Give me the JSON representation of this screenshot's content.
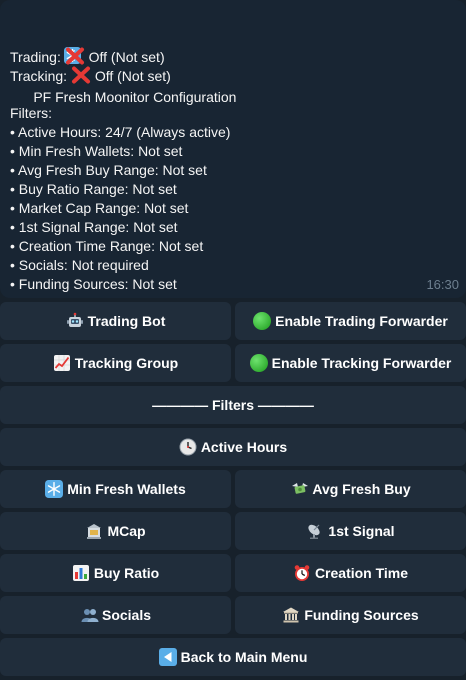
{
  "message": {
    "title_icon": "snowflake-icon",
    "title": "PF Fresh Moonitor Configuration",
    "trading_label": "Trading:",
    "trading_status": "Off (Not set)",
    "tracking_label": "Tracking:",
    "tracking_status": "Off (Not set)",
    "filters_heading": "Filters:",
    "filters": [
      "• Active Hours: 24/7 (Always active)",
      "• Min Fresh Wallets: Not set",
      "• Avg Fresh Buy Range: Not set",
      "• Buy Ratio Range: Not set",
      "• Market Cap Range: Not set",
      "• 1st Signal Range: Not set",
      "• Creation Time Range: Not set",
      "• Socials: Not required",
      "• Funding Sources: Not set"
    ],
    "time": "16:30"
  },
  "keyboard": {
    "trading_bot": "Trading Bot",
    "enable_trading_forwarder": "Enable Trading Forwarder",
    "tracking_group": "Tracking Group",
    "enable_tracking_forwarder": "Enable Tracking Forwarder",
    "filters_divider": "———— Filters ————",
    "active_hours": "Active Hours",
    "min_fresh_wallets": "Min Fresh Wallets",
    "avg_fresh_buy": "Avg Fresh Buy",
    "mcap": "MCap",
    "first_signal": "1st Signal",
    "buy_ratio": "Buy Ratio",
    "creation_time": "Creation Time",
    "socials": "Socials",
    "funding_sources": "Funding Sources",
    "back_to_main_menu": "Back to Main Menu"
  },
  "colors": {
    "background": "#17212b",
    "message_bubble": "#182533",
    "button": "#202d3b",
    "text": "#f5f5f5",
    "timestamp": "#6d7f8f",
    "cross_red": "#e53935",
    "status_green": "#2fb52f"
  }
}
